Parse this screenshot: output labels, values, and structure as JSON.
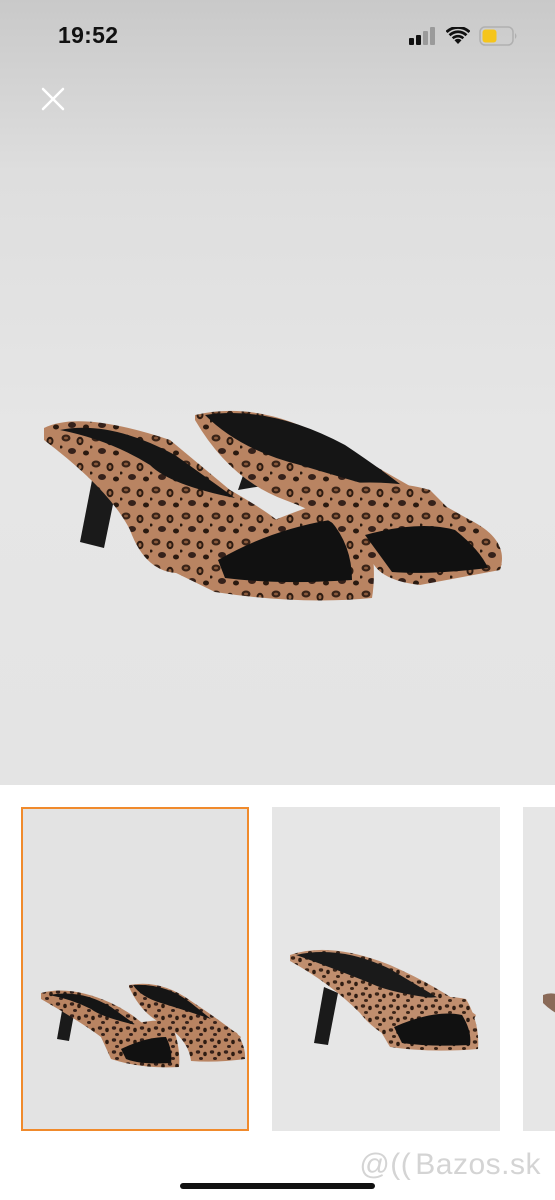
{
  "status_bar": {
    "time": "19:52",
    "icons": [
      "signal-icon",
      "wifi-icon",
      "battery-icon"
    ],
    "battery_color": "#f5c51c"
  },
  "toolbar": {
    "close_icon": "close-icon"
  },
  "gallery": {
    "main_image": "leopard print mule sandals pair",
    "thumbnails": [
      {
        "image": "leopard print mule sandals pair",
        "selected": true
      },
      {
        "image": "leopard print mule sandal side view",
        "selected": false
      },
      {
        "image": "leopard print mule sandal partial",
        "selected": false
      }
    ],
    "selected_border_color": "#f08a2c"
  },
  "watermark": {
    "text": "Bazos.sk",
    "logo": "@(("
  }
}
